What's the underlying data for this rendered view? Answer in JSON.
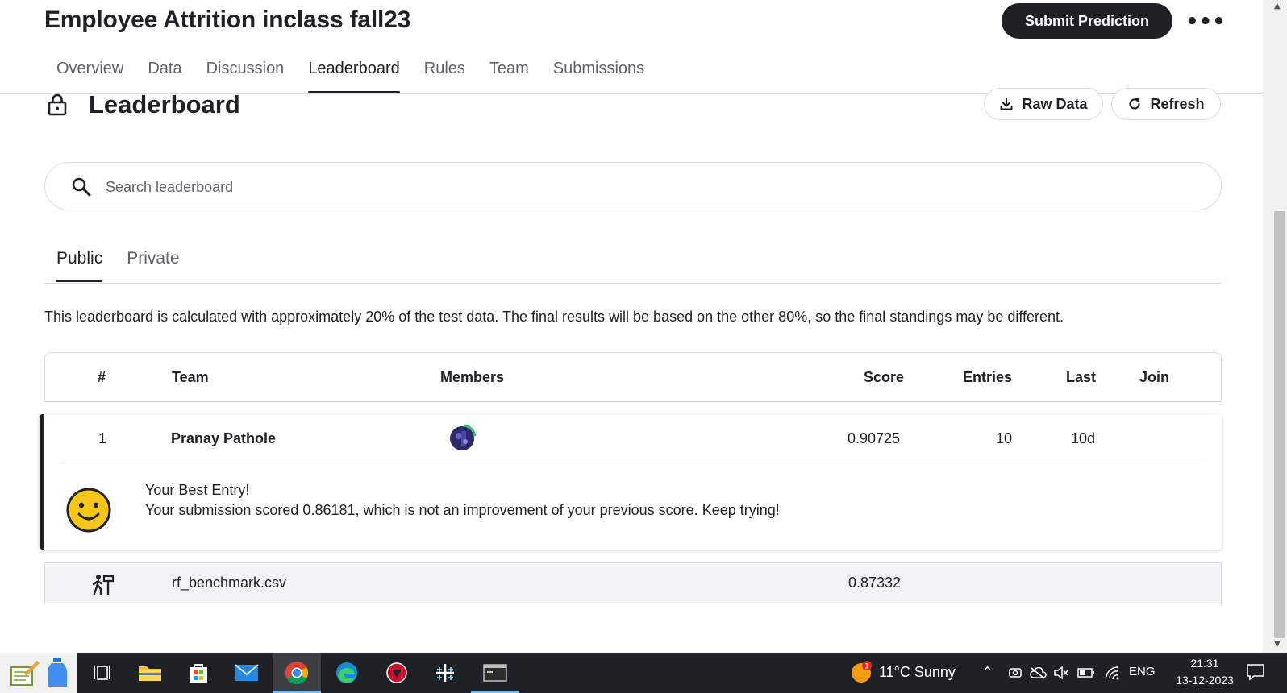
{
  "competition": {
    "title": "Employee Attrition inclass fall23",
    "submit_label": "Submit Prediction",
    "more_label": "•••"
  },
  "nav": {
    "tabs": [
      {
        "label": "Overview"
      },
      {
        "label": "Data"
      },
      {
        "label": "Discussion"
      },
      {
        "label": "Leaderboard"
      },
      {
        "label": "Rules"
      },
      {
        "label": "Team"
      },
      {
        "label": "Submissions"
      }
    ],
    "active_tab": "Leaderboard"
  },
  "leaderboard": {
    "title": "Leaderboard",
    "raw_data_label": "Raw Data",
    "refresh_label": "Refresh",
    "search_placeholder": "Search leaderboard",
    "subtabs": [
      {
        "label": "Public"
      },
      {
        "label": "Private"
      }
    ],
    "active_subtab": "Public",
    "notice": "This leaderboard is calculated with approximately 20% of the test data. The final results will be based on the other 80%, so the final standings may be different.",
    "columns": {
      "rank": "#",
      "team": "Team",
      "members": "Members",
      "score": "Score",
      "entries": "Entries",
      "last": "Last",
      "join": "Join"
    },
    "rows": [
      {
        "rank": "1",
        "team": "Pranay Pathole",
        "score": "0.90725",
        "entries": "10",
        "last": "10d"
      }
    ],
    "best_entry": {
      "title": "Your Best Entry!",
      "message": "Your submission scored 0.86181, which is not an improvement of your previous score. Keep trying!"
    },
    "benchmark": {
      "name": "rf_benchmark.csv",
      "score": "0.87332"
    }
  },
  "taskbar": {
    "weather": "11°C  Sunny",
    "weather_badge": "1",
    "language": "ENG",
    "time": "21:31",
    "date": "13-12-2023"
  },
  "colors": {
    "primary": "#202124",
    "muted": "#5f6368",
    "border": "#dadce0",
    "taskbar": "#1e2226",
    "accent": "#76b9ed",
    "smiley": "#f5c518"
  }
}
